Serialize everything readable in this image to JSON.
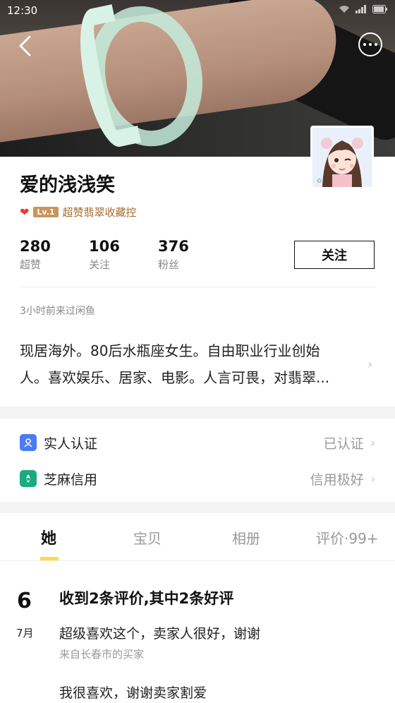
{
  "status_bar": {
    "time": "12:30"
  },
  "profile": {
    "name": "爱的浅浅笑",
    "level_badge": "Lv.1",
    "level_title": "超赞翡翠收藏控",
    "stats": [
      {
        "num": "280",
        "label": "超赞"
      },
      {
        "num": "106",
        "label": "关注"
      },
      {
        "num": "376",
        "label": "粉丝"
      }
    ],
    "follow_label": "关注",
    "last_seen": "3小时前来过闲鱼",
    "bio_line1": "现居海外。80后水瓶座女生。自由职业行业创始",
    "bio_line2": "人。喜欢娱乐、居家、电影。人言可畏，对翡翠..."
  },
  "verification": [
    {
      "label": "实人认证",
      "value": "已认证",
      "icon": "person-verify-icon",
      "color": "#4a7cf3"
    },
    {
      "label": "芝麻信用",
      "value": "信用极好",
      "icon": "sesame-credit-icon",
      "color": "#1aaa80"
    }
  ],
  "tabs": [
    {
      "label": "她",
      "active": true
    },
    {
      "label": "宝贝",
      "active": false
    },
    {
      "label": "相册",
      "active": false
    },
    {
      "label": "评价·99+",
      "active": false
    }
  ],
  "accent_color": "#ffda44",
  "feed": {
    "day": "6",
    "month": "7月",
    "title": "收到2条评价,其中2条好评",
    "review1_text": "超级喜欢这个，卖家人很好，谢谢",
    "review1_source": "来自长春市的买家",
    "review2_text": "我很喜欢，谢谢卖家割爱"
  }
}
